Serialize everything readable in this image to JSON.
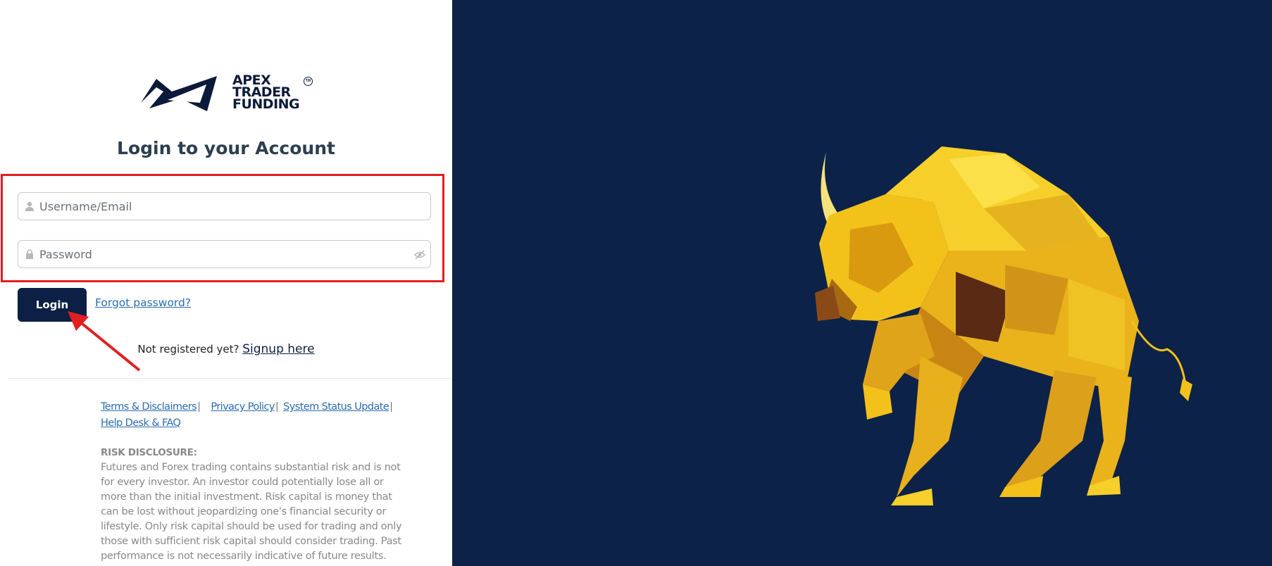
{
  "brand": {
    "line1": "APEX",
    "line2": "TRADER",
    "line3": "FUNDING",
    "tm": "TM"
  },
  "login": {
    "title": "Login to your Account",
    "username_placeholder": "Username/Email",
    "password_placeholder": "Password",
    "login_button": "Login",
    "forgot_password": "Forgot password?",
    "not_registered": "Not registered yet?",
    "signup_link": "Signup here"
  },
  "footer": {
    "links": [
      "Terms & Disclaimers",
      "Privacy Policy",
      "System Status Update",
      "Help Desk & FAQ"
    ],
    "separator": "|",
    "risk_title": "RISK DISCLOSURE:",
    "risk_text": "Futures and Forex trading contains substantial risk and is not for every investor. An investor could potentially lose all or more than the initial investment. Risk capital is money that can be lost without jeopardizing one's financial security or lifestyle. Only risk capital should be used for trading and only those with sufficient risk capital should consider trading. Past performance is not necessarily indicative of future results."
  },
  "icons": {
    "user": "user-icon",
    "lock": "lock-icon",
    "eye": "eye-slash-icon",
    "hero": "geometric-gold-bull"
  },
  "colors": {
    "navy": "#0c2248",
    "button": "#0c1f45",
    "link": "#2a6cb0",
    "annotation": "#e02020",
    "gold": "#f2c21a"
  }
}
